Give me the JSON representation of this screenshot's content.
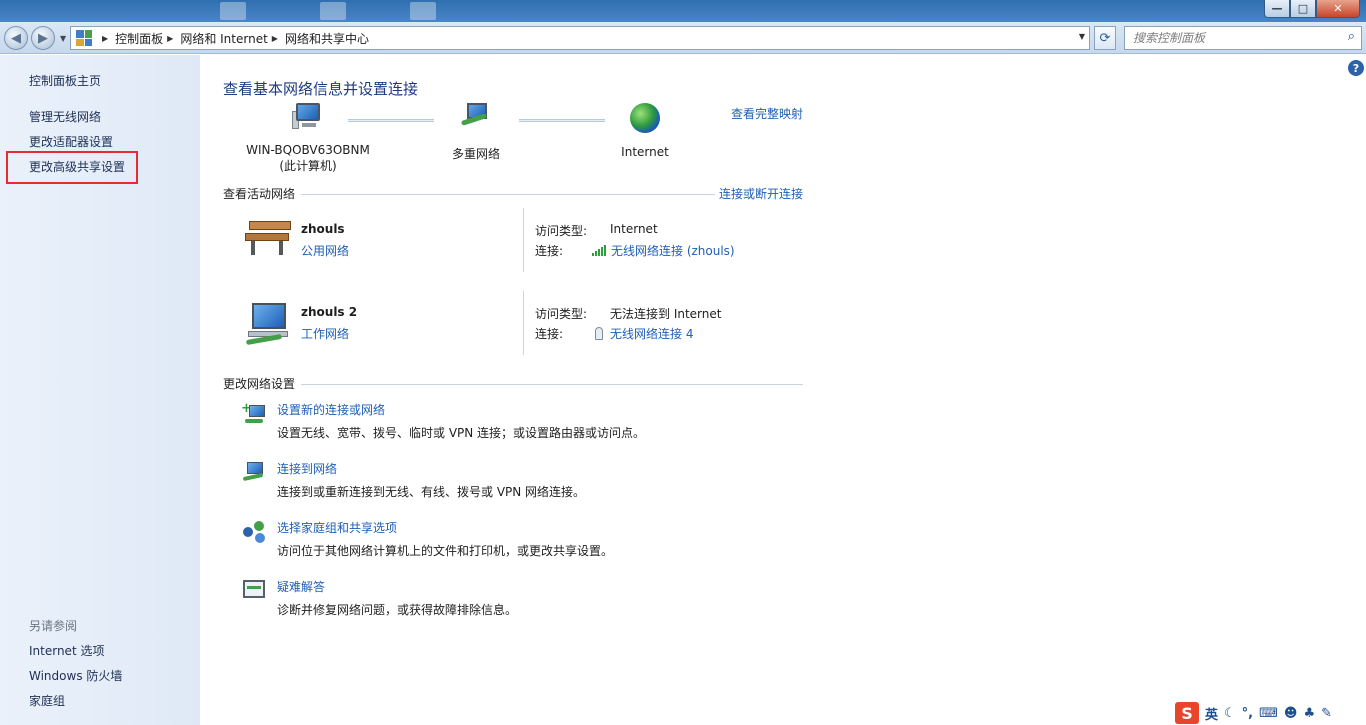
{
  "window": {
    "controls": {
      "minimize": "—",
      "maximize": "□",
      "close": "✕"
    }
  },
  "nav": {
    "back": "◀",
    "forward": "▶",
    "breadcrumbs": [
      "控制面板",
      "网络和 Internet",
      "网络和共享中心"
    ],
    "refresh": "⟳",
    "search_placeholder": "搜索控制面板"
  },
  "sidebar": {
    "home": "控制面板主页",
    "items": [
      "管理无线网络",
      "更改适配器设置",
      "更改高级共享设置"
    ],
    "highlighted_index": 2,
    "see_also_title": "另请参阅",
    "see_also": [
      "Internet 选项",
      "Windows 防火墙",
      "家庭组"
    ],
    "highlight_color": "#e62c2c"
  },
  "main": {
    "help": "?",
    "title": "查看基本网络信息并设置连接",
    "full_map_link": "查看完整映射",
    "map": {
      "computer_name": "WIN-BQOBV63OBNM",
      "computer_sub": "(此计算机)",
      "middle": "多重网络",
      "internet": "Internet"
    },
    "active_section": {
      "title": "查看活动网络",
      "action_link": "连接或断开连接",
      "networks": [
        {
          "name": "zhouls",
          "type": "公用网络",
          "access_label": "访问类型:",
          "access_value": "Internet",
          "conn_label": "连接:",
          "conn_value": "无线网络连接 (zhouls)",
          "icon": "park-bench-icon"
        },
        {
          "name": "zhouls  2",
          "type": "工作网络",
          "access_label": "访问类型:",
          "access_value": "无法连接到 Internet",
          "conn_label": "连接:",
          "conn_value": "无线网络连接 4",
          "icon": "work-network-icon"
        }
      ]
    },
    "change_section": {
      "title": "更改网络设置",
      "tasks": [
        {
          "title": "设置新的连接或网络",
          "desc": "设置无线、宽带、拨号、临时或 VPN 连接；或设置路由器或访问点。",
          "icon": "new-connection-icon"
        },
        {
          "title": "连接到网络",
          "desc": "连接到或重新连接到无线、有线、拨号或 VPN 网络连接。",
          "icon": "connect-network-icon"
        },
        {
          "title": "选择家庭组和共享选项",
          "desc": "访问位于其他网络计算机上的文件和打印机，或更改共享设置。",
          "icon": "homegroup-icon"
        },
        {
          "title": "疑难解答",
          "desc": "诊断并修复网络问题，或获得故障排除信息。",
          "icon": "troubleshoot-icon"
        }
      ]
    }
  },
  "tray": {
    "ime": "S",
    "lang": "英"
  },
  "colors": {
    "link": "#1f5fb4",
    "title": "#1e3b80",
    "sidebar_bg": "#e4edf8"
  }
}
